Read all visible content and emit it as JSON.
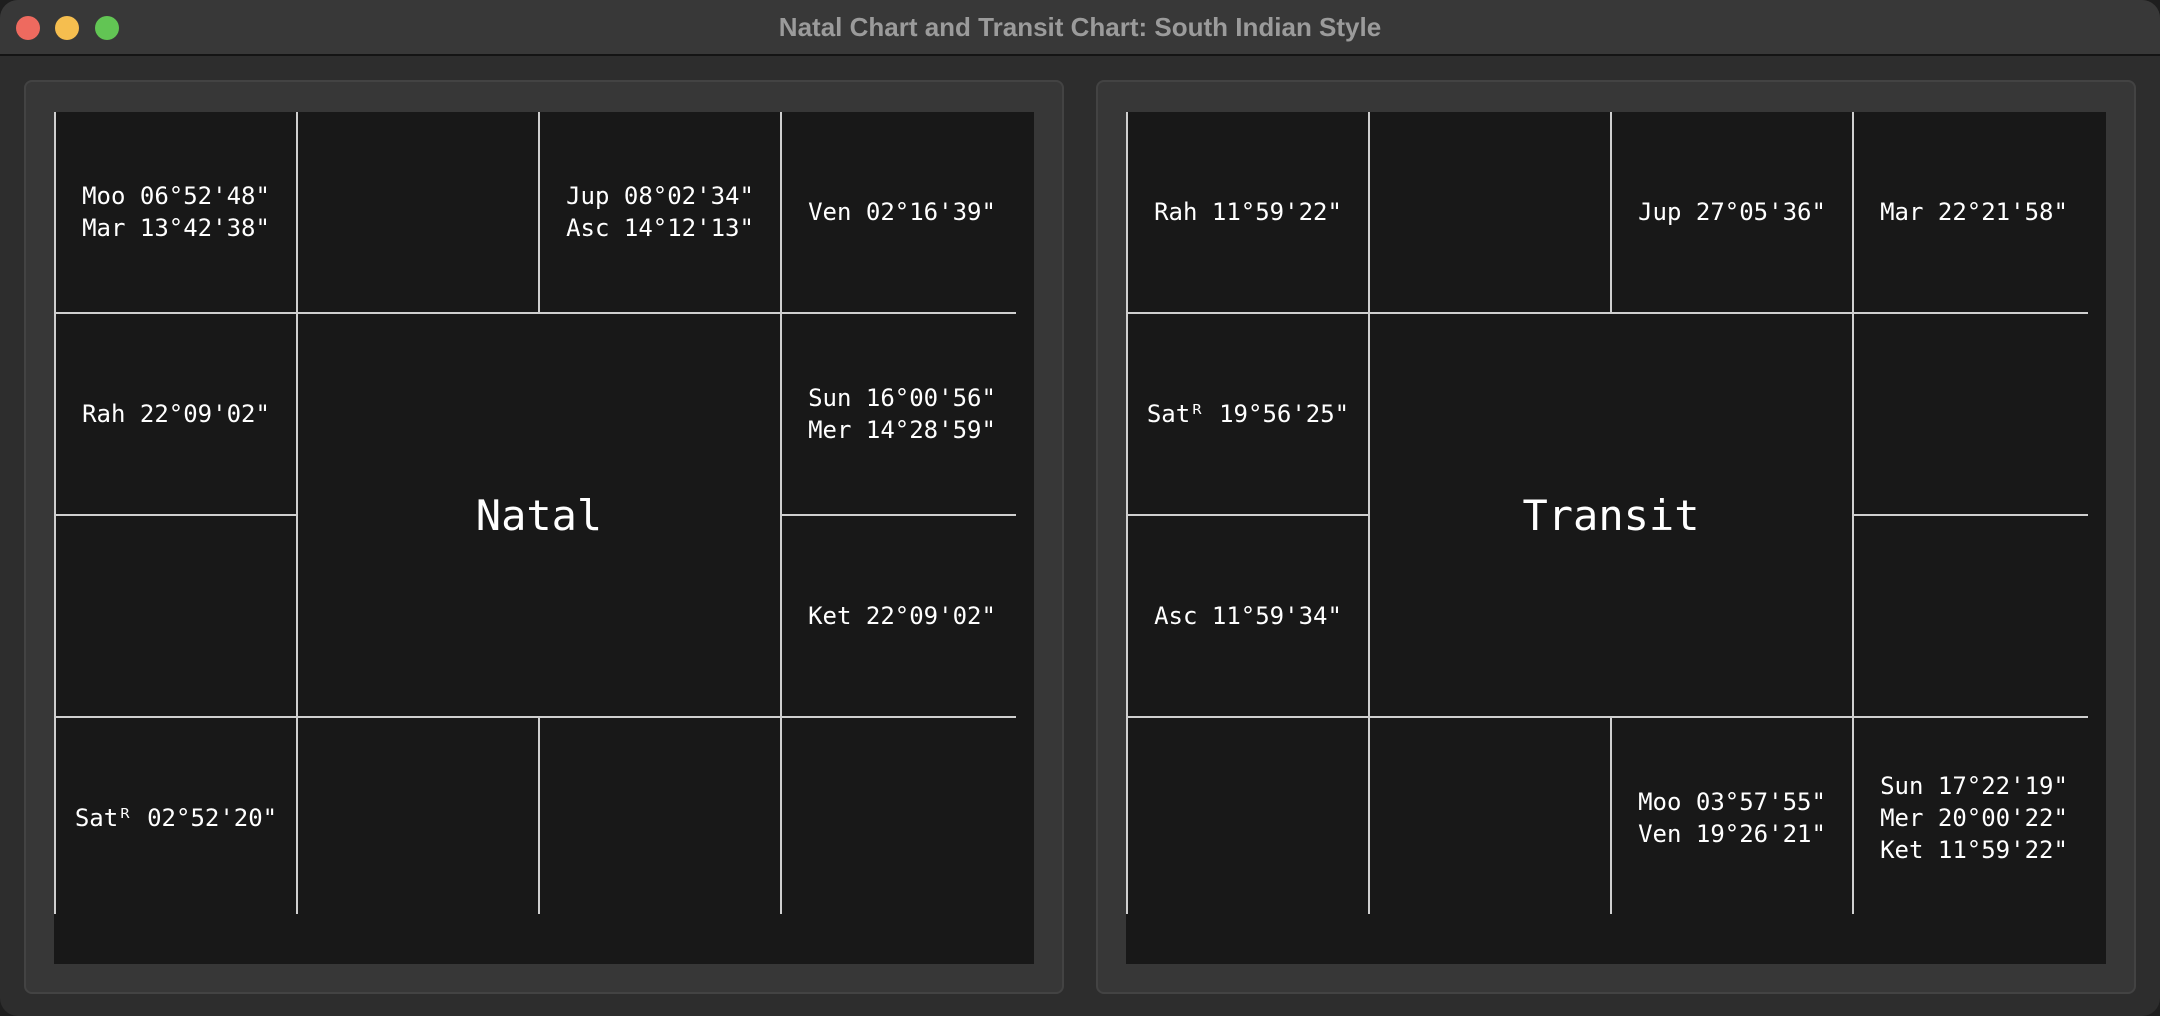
{
  "window": {
    "title": "Natal Chart and Transit Chart: South Indian Style"
  },
  "natal": {
    "center_label": "Natal",
    "cells": {
      "r1c1": [
        "Moo 06°52'48\"",
        "Mar 13°42'38\""
      ],
      "r1c2": [],
      "r1c3": [
        "Jup 08°02'34\"",
        "Asc 14°12'13\""
      ],
      "r1c4": [
        "Ven 02°16'39\""
      ],
      "r2c1": [
        "Rah 22°09'02\""
      ],
      "r2c4": [
        "Sun 16°00'56\"",
        "Mer 14°28'59\""
      ],
      "r3c1": [],
      "r3c4": [
        "Ket 22°09'02\""
      ],
      "r4c1": [
        "Satᴿ 02°52'20\""
      ],
      "r4c2": [],
      "r4c3": [],
      "r4c4": []
    }
  },
  "transit": {
    "center_label": "Transit",
    "cells": {
      "r1c1": [
        "Rah 11°59'22\""
      ],
      "r1c2": [],
      "r1c3": [
        "Jup 27°05'36\""
      ],
      "r1c4": [
        "Mar 22°21'58\""
      ],
      "r2c1": [
        "Satᴿ 19°56'25\""
      ],
      "r2c4": [],
      "r3c1": [
        "Asc 11°59'34\""
      ],
      "r3c4": [],
      "r4c1": [],
      "r4c2": [],
      "r4c3": [
        "Moo 03°57'55\"",
        "Ven 19°26'21\""
      ],
      "r4c4": [
        "Sun 17°22'19\"",
        "Mer 20°00'22\"",
        "Ket 11°59'22\""
      ]
    }
  }
}
